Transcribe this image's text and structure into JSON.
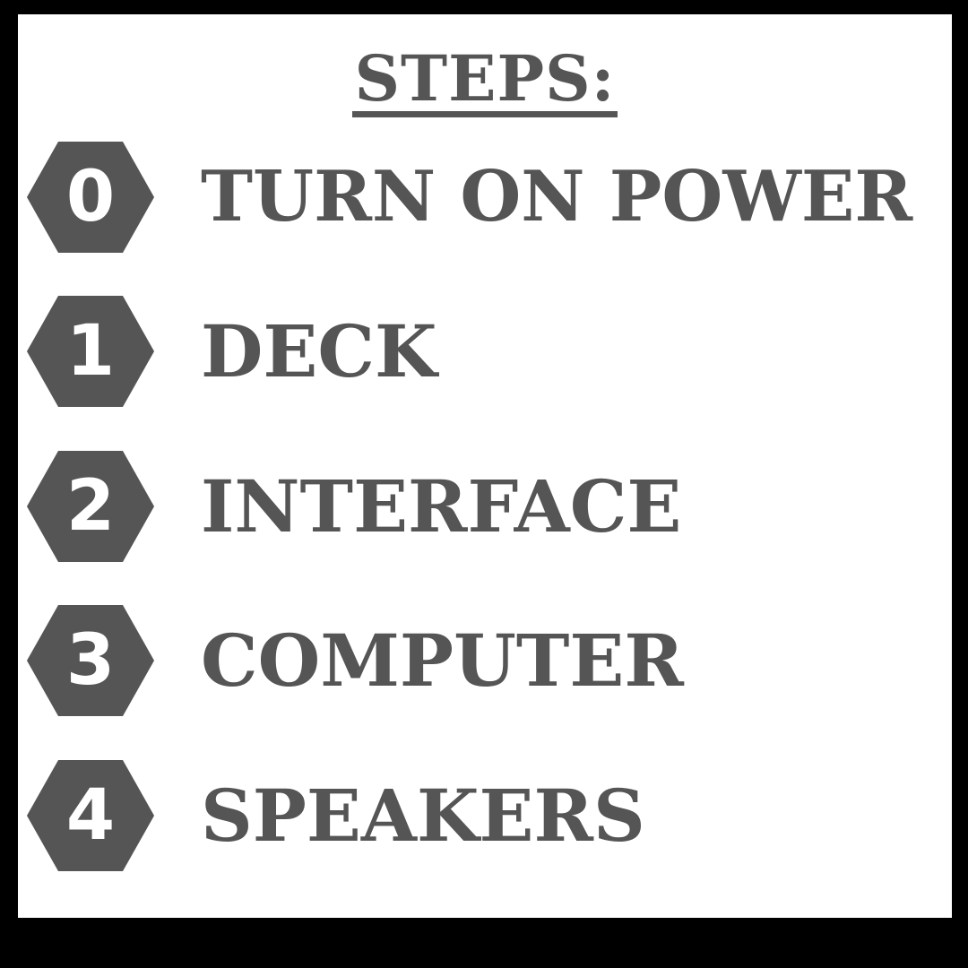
{
  "title": "STEPS:",
  "steps": [
    {
      "number": "0",
      "label": "TURN ON POWER"
    },
    {
      "number": "1",
      "label": "DECK"
    },
    {
      "number": "2",
      "label": "INTERFACE"
    },
    {
      "number": "3",
      "label": "COMPUTER"
    },
    {
      "number": "4",
      "label": "SPEAKERS"
    }
  ],
  "colors": {
    "frame": "#000000",
    "background": "#ffffff",
    "ink": "#555555",
    "hex_text": "#ffffff"
  },
  "icons": {
    "step_badge": "hexagon-icon"
  }
}
